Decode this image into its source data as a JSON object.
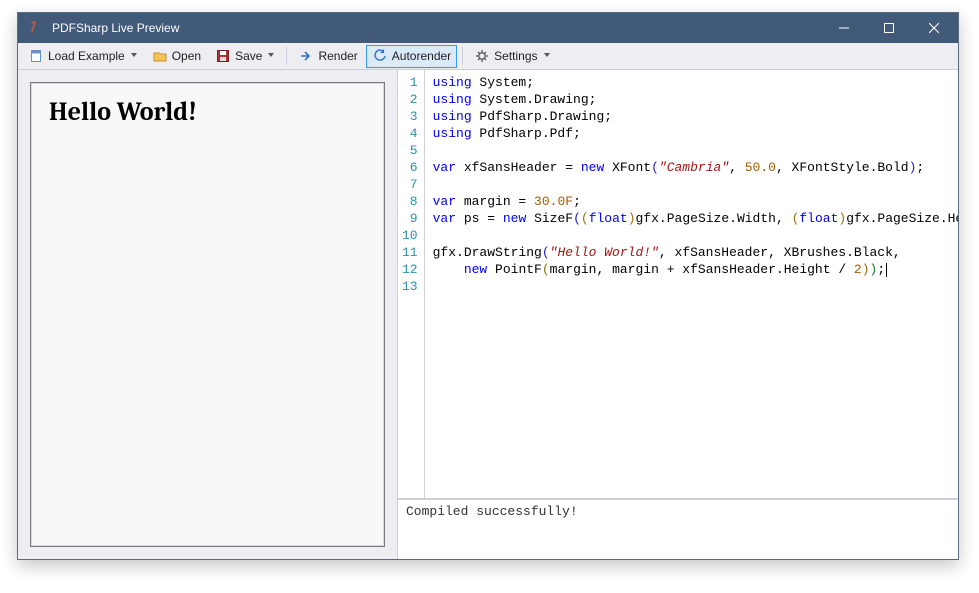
{
  "window": {
    "title": "PDFSharp Live Preview"
  },
  "toolbar": {
    "load_example": "Load Example",
    "open": "Open",
    "save": "Save",
    "render": "Render",
    "autorender": "Autorender",
    "settings": "Settings"
  },
  "preview": {
    "heading": "Hello World!"
  },
  "code": {
    "lines": [
      [
        {
          "t": "using ",
          "c": "kw"
        },
        {
          "t": "System;",
          "c": "pln"
        }
      ],
      [
        {
          "t": "using ",
          "c": "kw"
        },
        {
          "t": "System.Drawing;",
          "c": "pln"
        }
      ],
      [
        {
          "t": "using ",
          "c": "kw"
        },
        {
          "t": "PdfSharp.Drawing;",
          "c": "pln"
        }
      ],
      [
        {
          "t": "using ",
          "c": "kw"
        },
        {
          "t": "PdfSharp.Pdf;",
          "c": "pln"
        }
      ],
      [],
      [
        {
          "t": "var ",
          "c": "kw"
        },
        {
          "t": "xfSansHeader = ",
          "c": "pln"
        },
        {
          "t": "new ",
          "c": "kw"
        },
        {
          "t": "XFont",
          "c": "typ"
        },
        {
          "t": "(",
          "c": "paren3"
        },
        {
          "t": "\"Cambria\"",
          "c": "str"
        },
        {
          "t": ", ",
          "c": "pln"
        },
        {
          "t": "50.0",
          "c": "num"
        },
        {
          "t": ", XFontStyle.Bold",
          "c": "pln"
        },
        {
          "t": ")",
          "c": "paren3"
        },
        {
          "t": ";",
          "c": "pln"
        }
      ],
      [],
      [
        {
          "t": "var ",
          "c": "kw"
        },
        {
          "t": "margin = ",
          "c": "pln"
        },
        {
          "t": "30.0F",
          "c": "num"
        },
        {
          "t": ";",
          "c": "pln"
        }
      ],
      [
        {
          "t": "var ",
          "c": "kw"
        },
        {
          "t": "ps = ",
          "c": "pln"
        },
        {
          "t": "new ",
          "c": "kw"
        },
        {
          "t": "SizeF",
          "c": "typ"
        },
        {
          "t": "(",
          "c": "paren3"
        },
        {
          "t": "(",
          "c": "paren2"
        },
        {
          "t": "float",
          "c": "kw"
        },
        {
          "t": ")",
          "c": "paren2"
        },
        {
          "t": "gfx.PageSize.Width, ",
          "c": "pln"
        },
        {
          "t": "(",
          "c": "paren2"
        },
        {
          "t": "float",
          "c": "kw"
        },
        {
          "t": ")",
          "c": "paren2"
        },
        {
          "t": "gfx.PageSize.Height",
          "c": "pln"
        },
        {
          "t": ")",
          "c": "paren3"
        },
        {
          "t": ";",
          "c": "pln"
        }
      ],
      [],
      [
        {
          "t": "gfx.DrawString",
          "c": "pln"
        },
        {
          "t": "(",
          "c": "paren3"
        },
        {
          "t": "\"Hello World!\"",
          "c": "str"
        },
        {
          "t": ", xfSansHeader, XBrushes.Black,",
          "c": "pln"
        }
      ],
      [
        {
          "t": "    ",
          "c": "pln"
        },
        {
          "t": "new ",
          "c": "kw"
        },
        {
          "t": "PointF",
          "c": "typ"
        },
        {
          "t": "(",
          "c": "paren2"
        },
        {
          "t": "margin, margin + xfSansHeader.Height / ",
          "c": "pln"
        },
        {
          "t": "2",
          "c": "num"
        },
        {
          "t": ")",
          "c": "paren2"
        },
        {
          "t": ")",
          "c": "paren1"
        },
        {
          "t": ";",
          "c": "pln"
        }
      ],
      []
    ]
  },
  "status": {
    "message": "Compiled successfully!"
  }
}
